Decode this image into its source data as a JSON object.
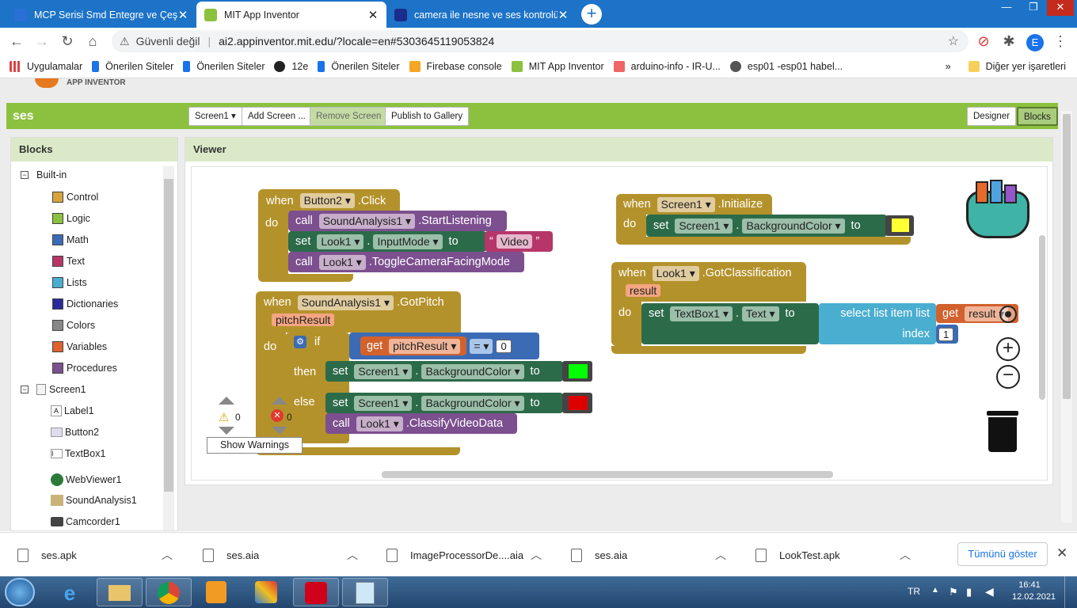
{
  "tabs": [
    {
      "title": "MCP Serisi Smd Entegre ve Çeşitl",
      "color": "#2a6fd6"
    },
    {
      "title": "MIT App Inventor",
      "color": "#8bc13f"
    },
    {
      "title": "camera ile nesne ve ses kontrolü",
      "color": "#1b2d8c"
    }
  ],
  "window_controls": [
    "—",
    "❐",
    "✕"
  ],
  "address": {
    "security": "Güvenli değil",
    "separator": "|",
    "url": "ai2.appinventor.mit.edu/?locale=en#5303645119053824"
  },
  "profile_letter": "E",
  "bookmarks": [
    {
      "label": "Uygulamalar",
      "color": "#d44"
    },
    {
      "label": "Önerilen Siteler",
      "color": "#1a73e8"
    },
    {
      "label": "Önerilen Siteler",
      "color": "#1a73e8"
    },
    {
      "label": "12e",
      "color": "#222"
    },
    {
      "label": "Önerilen Siteler",
      "color": "#1a73e8"
    },
    {
      "label": "Firebase console",
      "color": "#f5a623"
    },
    {
      "label": "MIT App Inventor",
      "color": "#8bc13f"
    },
    {
      "label": "arduino-info - IR-U...",
      "color": "#e66"
    },
    {
      "label": "esp01 -esp01 habel...",
      "color": "#555"
    }
  ],
  "other_bookmarks": "Diğer yer işaretleri",
  "app": {
    "logo_text": "APP INVENTOR",
    "project": "ses",
    "screen_btn": "Screen1 ▾",
    "add_screen": "Add Screen ...",
    "remove_screen": "Remove Screen",
    "publish": "Publish to Gallery",
    "designer": "Designer",
    "blocks": "Blocks",
    "blocks_panel_title": "Blocks",
    "viewer_title": "Viewer"
  },
  "tree": {
    "builtin": "Built-in",
    "items": [
      {
        "label": "Control",
        "color": "#d6a43a"
      },
      {
        "label": "Logic",
        "color": "#8bc13f"
      },
      {
        "label": "Math",
        "color": "#3b6bb5"
      },
      {
        "label": "Text",
        "color": "#b6366a"
      },
      {
        "label": "Lists",
        "color": "#4aaed0"
      },
      {
        "label": "Dictionaries",
        "color": "#2a2a9a"
      },
      {
        "label": "Colors",
        "color": "#888"
      },
      {
        "label": "Variables",
        "color": "#e0612d"
      },
      {
        "label": "Procedures",
        "color": "#7c4f8f"
      }
    ],
    "screen": "Screen1",
    "components": [
      "Label1",
      "Button2",
      "TextBox1",
      "WebViewer1",
      "SoundAnalysis1",
      "Camcorder1"
    ]
  },
  "blocks": {
    "b1_when": "when",
    "b1_comp": "Button2",
    "b1_event": ".Click",
    "b1_do": "do",
    "b1_call1": "call",
    "b1_comp1": "SoundAnalysis1",
    "b1_meth1": ".StartListening",
    "b1_set": "set",
    "b1_comp2": "Look1",
    "b1_prop": "InputMode",
    "b1_to": "to",
    "b1_val": "Video",
    "b1_call2": "call",
    "b1_comp3": "Look1",
    "b1_meth2": ".ToggleCameraFacingMode",
    "b2_when": "when",
    "b2_comp": "SoundAnalysis1",
    "b2_event": ".GotPitch",
    "b2_param": "pitchResult",
    "b2_do": "do",
    "b2_if": "if",
    "b2_get": "get",
    "b2_var": "pitchResult",
    "b2_op": "=",
    "b2_num": "0",
    "b2_then": "then",
    "b2_set1": "set",
    "b2_comp1": "Screen1",
    "b2_prop1": "BackgroundColor",
    "b2_to1": "to",
    "b2_else": "else",
    "b2_set2": "set",
    "b2_comp2": "Screen1",
    "b2_prop2": "BackgroundColor",
    "b2_to2": "to",
    "b2_call": "call",
    "b2_comp3": "Look1",
    "b2_meth": ".ClassifyVideoData",
    "b3_when": "when",
    "b3_comp": "Screen1",
    "b3_event": ".Initialize",
    "b3_do": "do",
    "b3_set": "set",
    "b3_comp1": "Screen1",
    "b3_prop": "BackgroundColor",
    "b3_to": "to",
    "b4_when": "when",
    "b4_comp": "Look1",
    "b4_event": ".GotClassification",
    "b4_param": "result",
    "b4_do": "do",
    "b4_set": "set",
    "b4_comp1": "TextBox1",
    "b4_prop": "Text",
    "b4_to": "to",
    "b4_select": "select list item",
    "b4_list": "list",
    "b4_get": "get",
    "b4_var": "result",
    "b4_index": "index",
    "b4_num": "1",
    "colors": {
      "green": "#00ff00",
      "red": "#dd0000",
      "yellow": "#ffff33"
    }
  },
  "warnings": {
    "warn_count": "0",
    "err_count": "0",
    "show": "Show Warnings"
  },
  "downloads": [
    "ses.apk",
    "ses.aia",
    "ImageProcessorDe....aia",
    "ses.aia",
    "LookTest.apk"
  ],
  "show_all": "Tümünü göster",
  "tray": {
    "lang": "TR",
    "time": "16:41",
    "date": "12.02.2021"
  }
}
